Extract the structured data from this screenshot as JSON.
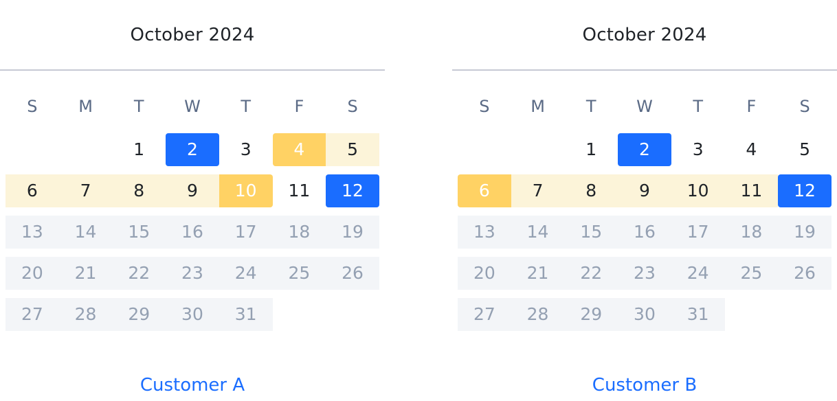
{
  "weekdays": [
    "S",
    "M",
    "T",
    "W",
    "T",
    "F",
    "S"
  ],
  "colors": {
    "selected": "#1a6dff",
    "range_endpoint": "#ffd264",
    "range_fill": "#fcf4d9",
    "future_fill": "#f3f5f8",
    "future_text": "#94a0b2",
    "link": "#1a6dff"
  },
  "calendars": [
    {
      "month_title": "October 2024",
      "customer_label": "Customer A",
      "weeks": [
        [
          {
            "d": "",
            "s": "empty"
          },
          {
            "d": "",
            "s": "empty"
          },
          {
            "d": "1",
            "s": "normal"
          },
          {
            "d": "2",
            "s": "selected"
          },
          {
            "d": "3",
            "s": "normal"
          },
          {
            "d": "4",
            "s": "range-start"
          },
          {
            "d": "5",
            "s": "in-range"
          }
        ],
        [
          {
            "d": "6",
            "s": "in-range"
          },
          {
            "d": "7",
            "s": "in-range"
          },
          {
            "d": "8",
            "s": "in-range"
          },
          {
            "d": "9",
            "s": "in-range"
          },
          {
            "d": "10",
            "s": "range-end"
          },
          {
            "d": "11",
            "s": "normal"
          },
          {
            "d": "12",
            "s": "selected"
          }
        ],
        [
          {
            "d": "13",
            "s": "future"
          },
          {
            "d": "14",
            "s": "future"
          },
          {
            "d": "15",
            "s": "future"
          },
          {
            "d": "16",
            "s": "future"
          },
          {
            "d": "17",
            "s": "future"
          },
          {
            "d": "18",
            "s": "future"
          },
          {
            "d": "19",
            "s": "future"
          }
        ],
        [
          {
            "d": "20",
            "s": "future"
          },
          {
            "d": "21",
            "s": "future"
          },
          {
            "d": "22",
            "s": "future"
          },
          {
            "d": "23",
            "s": "future"
          },
          {
            "d": "24",
            "s": "future"
          },
          {
            "d": "25",
            "s": "future"
          },
          {
            "d": "26",
            "s": "future"
          }
        ],
        [
          {
            "d": "27",
            "s": "future"
          },
          {
            "d": "28",
            "s": "future"
          },
          {
            "d": "29",
            "s": "future"
          },
          {
            "d": "30",
            "s": "future"
          },
          {
            "d": "31",
            "s": "future"
          },
          {
            "d": "",
            "s": "empty"
          },
          {
            "d": "",
            "s": "empty"
          }
        ]
      ]
    },
    {
      "month_title": "October 2024",
      "customer_label": "Customer B",
      "weeks": [
        [
          {
            "d": "",
            "s": "empty"
          },
          {
            "d": "",
            "s": "empty"
          },
          {
            "d": "1",
            "s": "normal"
          },
          {
            "d": "2",
            "s": "selected"
          },
          {
            "d": "3",
            "s": "normal"
          },
          {
            "d": "4",
            "s": "normal"
          },
          {
            "d": "5",
            "s": "normal"
          }
        ],
        [
          {
            "d": "6",
            "s": "range-start"
          },
          {
            "d": "7",
            "s": "in-range"
          },
          {
            "d": "8",
            "s": "in-range"
          },
          {
            "d": "9",
            "s": "in-range"
          },
          {
            "d": "10",
            "s": "in-range"
          },
          {
            "d": "11",
            "s": "in-range"
          },
          {
            "d": "12",
            "s": "selected"
          }
        ],
        [
          {
            "d": "13",
            "s": "future"
          },
          {
            "d": "14",
            "s": "future"
          },
          {
            "d": "15",
            "s": "future"
          },
          {
            "d": "16",
            "s": "future"
          },
          {
            "d": "17",
            "s": "future"
          },
          {
            "d": "18",
            "s": "future"
          },
          {
            "d": "19",
            "s": "future"
          }
        ],
        [
          {
            "d": "20",
            "s": "future"
          },
          {
            "d": "21",
            "s": "future"
          },
          {
            "d": "22",
            "s": "future"
          },
          {
            "d": "23",
            "s": "future"
          },
          {
            "d": "24",
            "s": "future"
          },
          {
            "d": "25",
            "s": "future"
          },
          {
            "d": "26",
            "s": "future"
          }
        ],
        [
          {
            "d": "27",
            "s": "future"
          },
          {
            "d": "28",
            "s": "future"
          },
          {
            "d": "29",
            "s": "future"
          },
          {
            "d": "30",
            "s": "future"
          },
          {
            "d": "31",
            "s": "future"
          },
          {
            "d": "",
            "s": "empty"
          },
          {
            "d": "",
            "s": "empty"
          }
        ]
      ]
    }
  ]
}
